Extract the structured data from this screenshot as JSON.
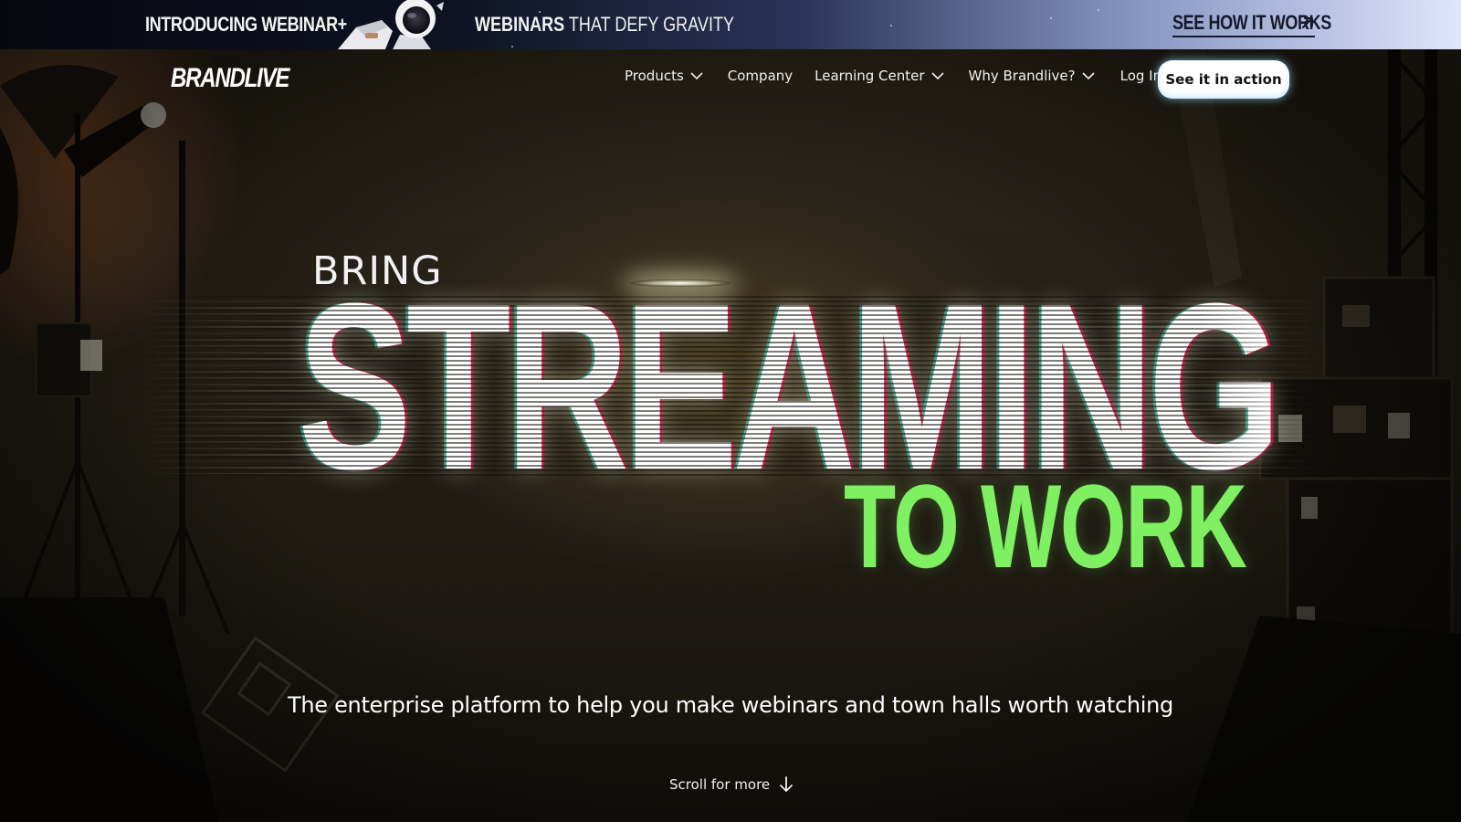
{
  "banner": {
    "intro": "INTRODUCING WEBINAR+",
    "tagline_bold": "WEBINARS",
    "tagline_rest": " THAT DEFY GRAVITY",
    "cta": "SEE HOW IT WORKS",
    "cta_icon": "arrow-up-right-icon",
    "image": "astronaut"
  },
  "brand": {
    "logo": "BRANDLIVE"
  },
  "nav": {
    "items": [
      {
        "label": "Products",
        "dropdown": true
      },
      {
        "label": "Company",
        "dropdown": false
      },
      {
        "label": "Learning Center",
        "dropdown": true
      },
      {
        "label": "Why Brandlive?",
        "dropdown": true
      },
      {
        "label": "Log In",
        "dropdown": false
      }
    ],
    "cta": "See it in action"
  },
  "hero": {
    "line1": "BRING",
    "line2": "STREAMING",
    "line3": "TO WORK",
    "subhead": "The enterprise platform to help you make webinars and town halls worth watching",
    "scroll": "Scroll for more",
    "scroll_icon": "arrow-down-icon",
    "accent_color": "#7ff062"
  }
}
